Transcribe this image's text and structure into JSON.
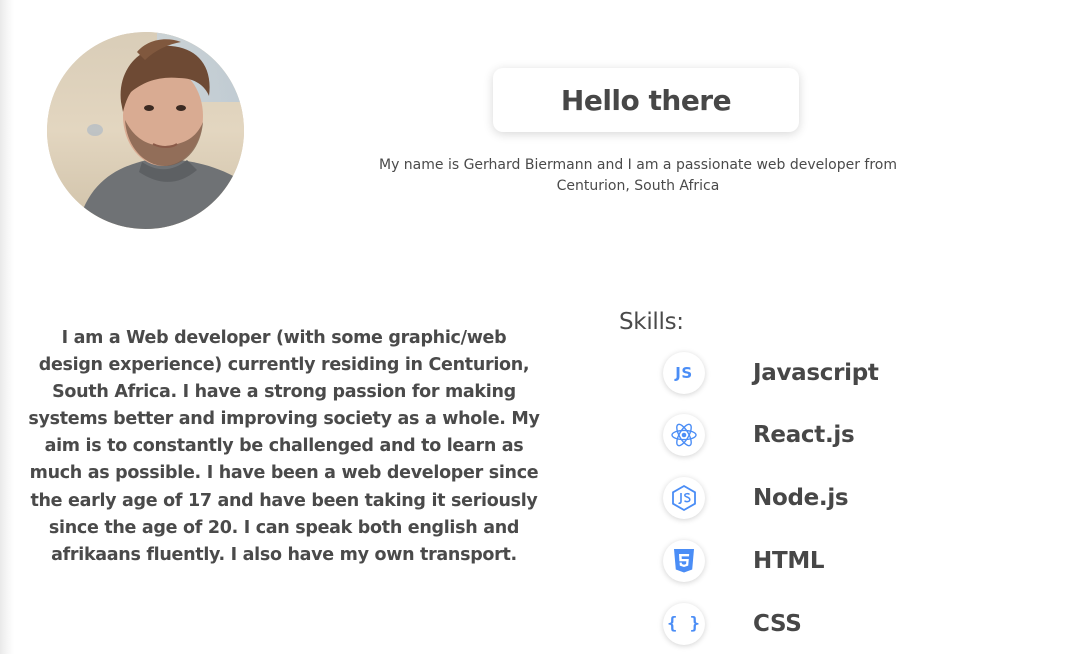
{
  "header": {
    "title": "Hello there",
    "intro": "My name is Gerhard Biermann and I am a passionate web developer from Centurion, South Africa"
  },
  "about": {
    "text": "I am a Web developer (with some graphic/web design experience) currently residing in Centurion, South Africa. I have a strong passion for making systems better and improving society as a whole. My aim is to constantly be challenged and to learn as much as possible. I have been a web developer since the early age of 17 and have been taking it seriously since the age of 20. I can speak both english and afrikaans fluently. I also have my own transport."
  },
  "skills": {
    "heading": "Skills:",
    "items": [
      {
        "label": "Javascript",
        "icon": "javascript-icon",
        "glyph": "JS"
      },
      {
        "label": "React.js",
        "icon": "react-icon"
      },
      {
        "label": "Node.js",
        "icon": "nodejs-icon"
      },
      {
        "label": "HTML",
        "icon": "html5-icon"
      },
      {
        "label": "CSS",
        "icon": "css-icon",
        "glyph": "{ }"
      }
    ]
  },
  "colors": {
    "accent": "#4a8df6",
    "text": "#4a4a4a"
  }
}
